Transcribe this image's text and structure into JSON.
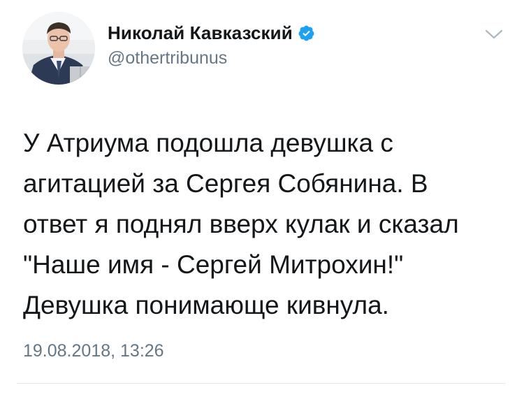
{
  "author": {
    "display_name": "Николай Кавказский",
    "handle": "@othertribunus",
    "verified": true,
    "avatar_icon": "user-photo-avatar"
  },
  "tweet": {
    "text": "У Атриума подошла девушка с\nагитацией за Сергея Собянина. В\nответ я поднял вверх кулак и сказал\n\"Наше имя - Сергей Митрохин!\"\nДевушка понимающе кивнула.",
    "timestamp": "19.08.2018, 13:26"
  },
  "icons": {
    "verified": "verified-badge-icon",
    "menu": "chevron-down-icon"
  },
  "colors": {
    "verified_blue": "#1da1f2",
    "text_primary": "#14171a",
    "text_secondary": "#657786",
    "caret": "#aab8c2",
    "divider": "#e1e8ed"
  }
}
